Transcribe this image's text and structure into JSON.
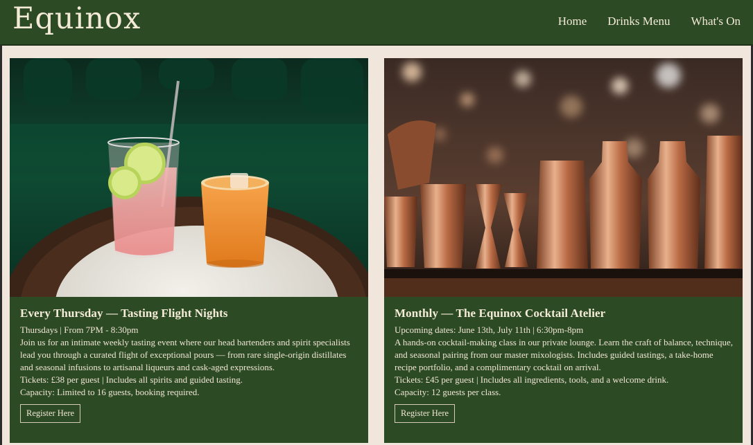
{
  "header": {
    "brand": "Equinox",
    "nav": [
      "Home",
      "Drinks Menu",
      "What's On"
    ]
  },
  "events": [
    {
      "image": "cocktails-on-table-photo",
      "title": "Every Thursday — Tasting Flight Nights",
      "schedule": "Thursdays | From 7PM - 8:30pm",
      "description": "Join us for an intimate weekly tasting event where our head bartenders and spirit specialists lead you through a curated flight of exceptional pours — from rare single-origin distillates and seasonal infusions to artisanal liqueurs and cask-aged expressions.",
      "tickets": "Tickets: £38 per guest | Includes all spirits and guided tasting.",
      "capacity": "Capacity: Limited to 16 guests, booking required.",
      "button": "Register Here"
    },
    {
      "image": "copper-bar-tools-photo",
      "title": "Monthly — The Equinox Cocktail Atelier",
      "schedule": "Upcoming dates: June 13th, July 11th | 6:30pm-8pm",
      "description": "A hands-on cocktail-making class in our private lounge. Learn the craft of balance, technique, and seasonal pairing from our master mixologists. Includes guided tastings, a take-home recipe portfolio, and a complimentary cocktail on arrival.",
      "tickets": "Tickets: £45 per guest | Includes all ingredients, tools, and a welcome drink.",
      "capacity": "Capacity: 12 guests per class.",
      "button": "Register Here"
    }
  ],
  "colors": {
    "header_bg": "#2c4a24",
    "page_bg": "#f1e6dc",
    "card_bg": "#2c4a24",
    "text": "#f1e6d6"
  }
}
